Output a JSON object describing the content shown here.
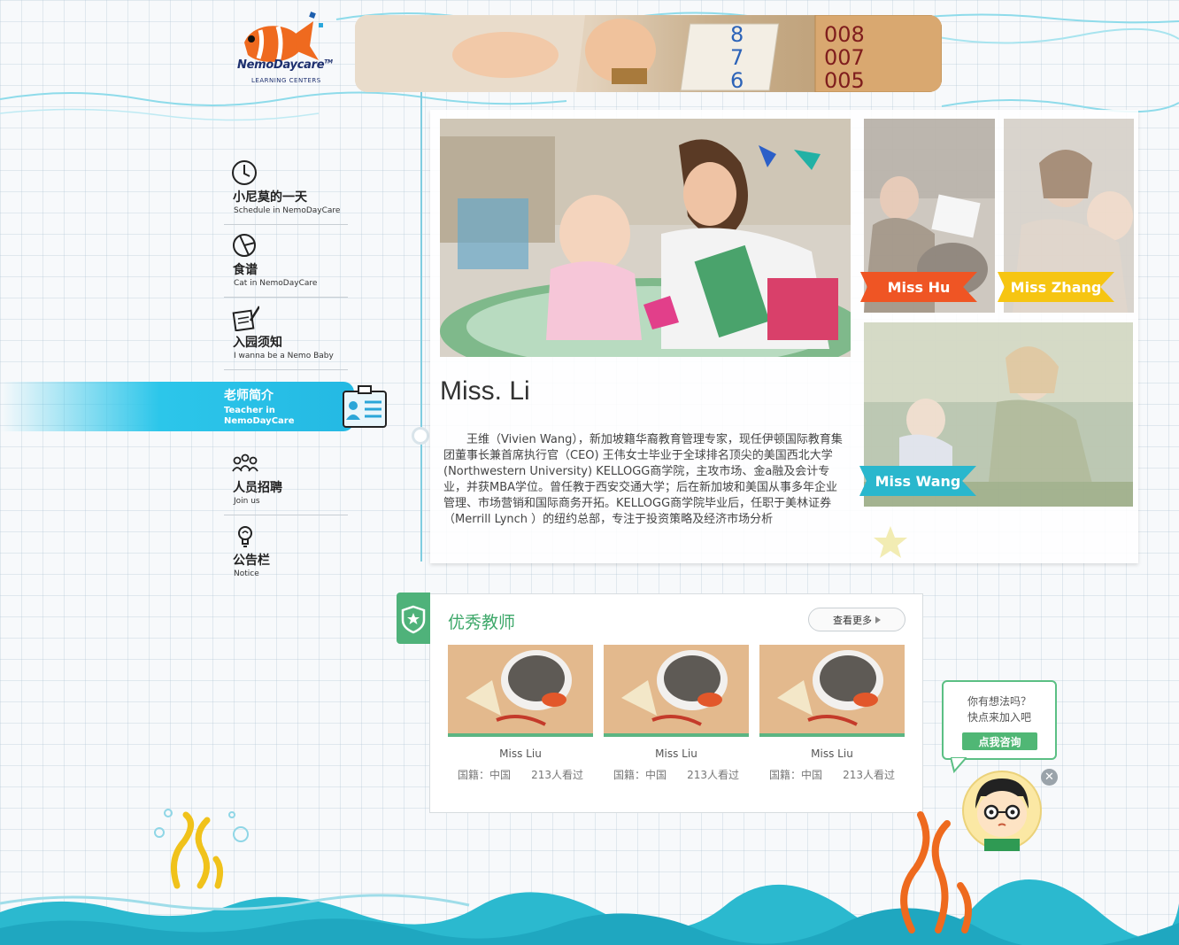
{
  "logo": {
    "brand": "NemoDaycare",
    "tm": "TM",
    "sub": "LEARNING CENTERS"
  },
  "nav": {
    "items": [
      {
        "title": "小尼莫的一天",
        "sub": "Schedule in NemoDayCare",
        "icon": "clock-icon"
      },
      {
        "title": "食谱",
        "sub": "Cat in NemoDayCare",
        "icon": "pie-icon"
      },
      {
        "title": "入园须知",
        "sub": "I wanna be a Nemo Baby",
        "icon": "notepad-pen-icon"
      },
      {
        "title": "人员招聘",
        "sub": "Join us",
        "icon": "people-icon"
      },
      {
        "title": "公告栏",
        "sub": "Notice",
        "icon": "lightbulb-icon"
      }
    ],
    "active": {
      "title": "老师简介",
      "sub1": "Teacher in",
      "sub2": "NemoDayCare",
      "icon": "id-badge-icon"
    }
  },
  "teacher": {
    "name": "Miss. Li",
    "description": "王维（Vivien Wang），新加坡籍华裔教育管理专家，现任伊顿国际教育集团董事长兼首席执行官（CEO) 王伟女士毕业于全球排名顶尖的美国西北大学 (Northwestern University) KELLOGG商学院，主攻市场、金a融及会计专业，并获MBA学位。曾任教于西安交通大学；后在新加坡和美国从事多年企业管理、市场营销和国际商务开拓。KELLOGG商学院毕业后，任职于美林证券（Merrill Lynch ）的纽约总部，专注于投资策略及经济市场分析"
  },
  "side_teachers": [
    {
      "name": "Miss Hu",
      "color": "#ef5524"
    },
    {
      "name": "Miss Zhang",
      "color": "#f6c512"
    },
    {
      "name": "Miss Wang",
      "color": "#2ab7cd"
    }
  ],
  "excellent": {
    "title": "优秀教师",
    "more": "查看更多",
    "cards": [
      {
        "name": "Miss Liu",
        "nation": "国籍：中国",
        "views": "213人看过"
      },
      {
        "name": "Miss Liu",
        "nation": "国籍：中国",
        "views": "213人看过"
      },
      {
        "name": "Miss Liu",
        "nation": "国籍：中国",
        "views": "213人看过"
      }
    ]
  },
  "consult": {
    "line1": "你有想法吗？",
    "line2": "快点来加入吧",
    "button": "点我咨询",
    "close": "✕"
  },
  "colors": {
    "accent_green": "#4fb27a",
    "nav_active": "#2cc6ea",
    "wave": "#2bb9cf"
  }
}
